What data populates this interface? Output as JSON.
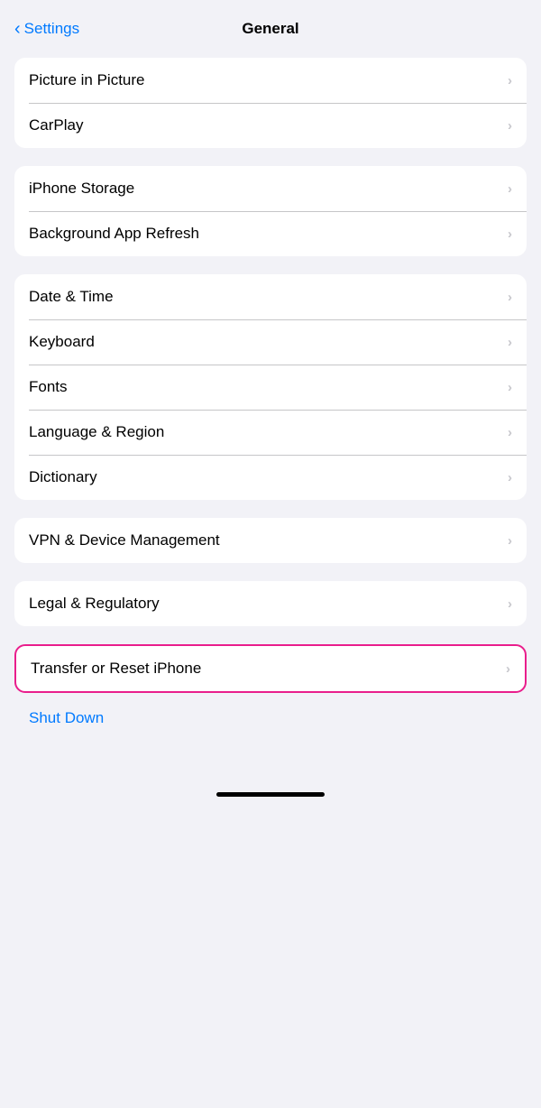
{
  "header": {
    "back_label": "Settings",
    "title": "General"
  },
  "groups": [
    {
      "id": "group1",
      "items": [
        {
          "id": "picture-in-picture",
          "label": "Picture in Picture",
          "has_chevron": true
        },
        {
          "id": "carplay",
          "label": "CarPlay",
          "has_chevron": true
        }
      ]
    },
    {
      "id": "group2",
      "items": [
        {
          "id": "iphone-storage",
          "label": "iPhone Storage",
          "has_chevron": true
        },
        {
          "id": "background-app-refresh",
          "label": "Background App Refresh",
          "has_chevron": true
        }
      ]
    },
    {
      "id": "group3",
      "items": [
        {
          "id": "date-time",
          "label": "Date & Time",
          "has_chevron": true
        },
        {
          "id": "keyboard",
          "label": "Keyboard",
          "has_chevron": true
        },
        {
          "id": "fonts",
          "label": "Fonts",
          "has_chevron": true
        },
        {
          "id": "language-region",
          "label": "Language & Region",
          "has_chevron": true
        },
        {
          "id": "dictionary",
          "label": "Dictionary",
          "has_chevron": true
        }
      ]
    },
    {
      "id": "group4",
      "items": [
        {
          "id": "vpn-device-management",
          "label": "VPN & Device Management",
          "has_chevron": true
        }
      ]
    },
    {
      "id": "group5",
      "items": [
        {
          "id": "legal-regulatory",
          "label": "Legal & Regulatory",
          "has_chevron": true
        }
      ]
    }
  ],
  "highlighted_item": {
    "id": "transfer-reset",
    "label": "Transfer or Reset iPhone",
    "has_chevron": true
  },
  "shutdown": {
    "label": "Shut Down"
  },
  "home_indicator": {
    "visible": true
  },
  "icons": {
    "chevron_left": "‹",
    "chevron_right": "›"
  }
}
